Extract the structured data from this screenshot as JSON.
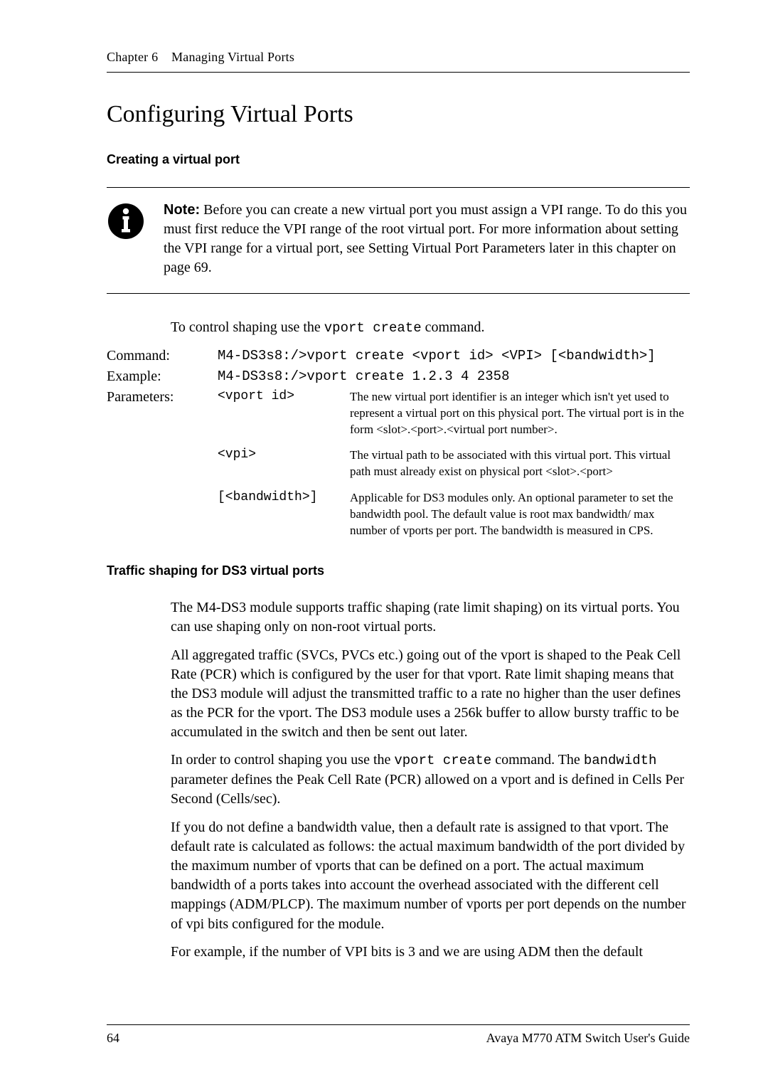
{
  "running_head": {
    "chapter": "Chapter 6",
    "title": "Managing Virtual Ports"
  },
  "section_title": "Configuring Virtual Ports",
  "subhead_create": "Creating a virtual port",
  "note": {
    "label": "Note:",
    "text": "Before you can create a new virtual port you must assign a VPI range. To do this you must first reduce the VPI range of the root virtual port. For more information about setting the VPI range for a virtual port, see Setting Virtual Port Parameters later in this chapter on page 69."
  },
  "intro_before": "To control shaping use the ",
  "intro_code": "vport create",
  "intro_after": " command.",
  "cmd": {
    "label_command": "Command:",
    "command_value": "M4-DS3s8:/>vport create <vport id> <VPI> [<bandwidth>]",
    "label_example": "Example:",
    "example_value": "M4-DS3s8:/>vport create 1.2.3 4 2358",
    "label_params": "Parameters:",
    "params": [
      {
        "name": "<vport id>",
        "desc": "The new virtual port identifier is an integer which isn't yet used to represent a virtual port on this physical port. The virtual port is in the form <slot>.<port>.<virtual port number>."
      },
      {
        "name": "<vpi>",
        "desc": "The virtual path to be associated with this virtual port. This virtual path must already exist on physical port <slot>.<port>"
      },
      {
        "name": "[<bandwidth>]",
        "desc": "Applicable for DS3 modules only. An optional parameter to set the bandwidth pool. The default value is root max bandwidth/ max number of vports per port. The bandwidth is measured in CPS."
      }
    ]
  },
  "subhead_traffic": "Traffic shaping for DS3 virtual ports",
  "body": {
    "p1": "The M4-DS3 module supports traffic shaping (rate limit shaping) on its virtual ports. You can use shaping only on non-root virtual ports.",
    "p2": "All aggregated traffic (SVCs, PVCs etc.) going out of the vport is shaped to the Peak Cell Rate (PCR) which is configured by the user for that vport. Rate limit shaping means that the DS3 module will adjust the transmitted traffic to a rate no higher than the user defines as the PCR for the vport. The DS3 module uses a 256k buffer to allow bursty traffic to be accumulated in the switch and then be sent out later.",
    "p3_before": "In order to control shaping you use the ",
    "p3_code1": "vport create",
    "p3_mid": " command. The ",
    "p3_code2": "bandwidth",
    "p3_after": " parameter defines the Peak Cell Rate (PCR) allowed on a vport and is defined in Cells Per Second (Cells/sec).",
    "p4": "If you do not define a bandwidth value, then a default rate is assigned to that vport. The default rate is calculated as follows: the actual maximum bandwidth of the port divided by the maximum number of vports that can be defined on a port. The actual maximum bandwidth of a ports takes into account the overhead associated with the different cell mappings (ADM/PLCP). The maximum number of vports per port depends on the number of vpi bits configured for the module.",
    "p5": "For example, if the number of VPI bits is 3 and we are using ADM then the default"
  },
  "footer": {
    "page": "64",
    "doc": "Avaya M770 ATM Switch User's Guide"
  }
}
